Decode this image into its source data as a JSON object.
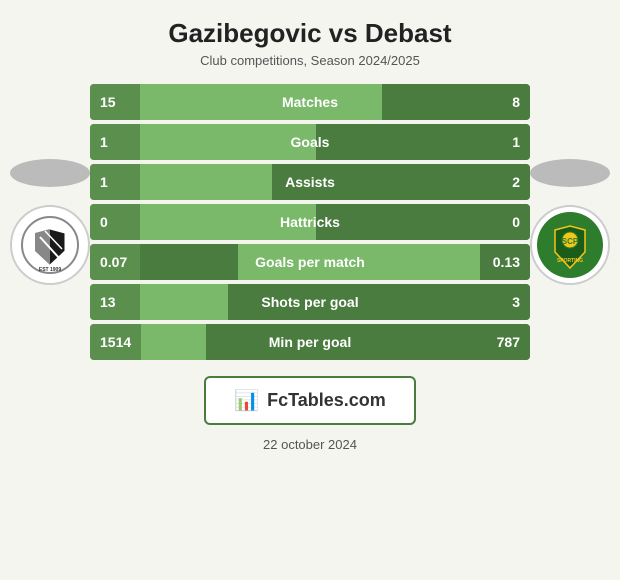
{
  "header": {
    "title": "Gazibegovic vs Debast",
    "subtitle": "Club competitions, Season 2024/2025"
  },
  "stats": [
    {
      "id": "matches",
      "label": "Matches",
      "left": "15",
      "right": "8",
      "rowClass": "row-matches",
      "fillSide": "left"
    },
    {
      "id": "goals",
      "label": "Goals",
      "left": "1",
      "right": "1",
      "rowClass": "row-goals",
      "fillSide": "left"
    },
    {
      "id": "assists",
      "label": "Assists",
      "left": "1",
      "right": "2",
      "rowClass": "row-assists",
      "fillSide": "left"
    },
    {
      "id": "hattricks",
      "label": "Hattricks",
      "left": "0",
      "right": "0",
      "rowClass": "row-hattricks",
      "fillSide": "left"
    },
    {
      "id": "gpm",
      "label": "Goals per match",
      "left": "0.07",
      "right": "0.13",
      "rowClass": "row-gpm",
      "fillSide": "right"
    },
    {
      "id": "spg",
      "label": "Shots per goal",
      "left": "13",
      "right": "3",
      "rowClass": "row-spg",
      "fillSide": "left"
    },
    {
      "id": "mpg",
      "label": "Min per goal",
      "left": "1514",
      "right": "787",
      "rowClass": "row-mpg",
      "fillSide": "left"
    }
  ],
  "banner": {
    "icon": "📊",
    "text_plain": "Fc",
    "text_colored": "Tables.com"
  },
  "footer": {
    "date": "22 october 2024"
  }
}
